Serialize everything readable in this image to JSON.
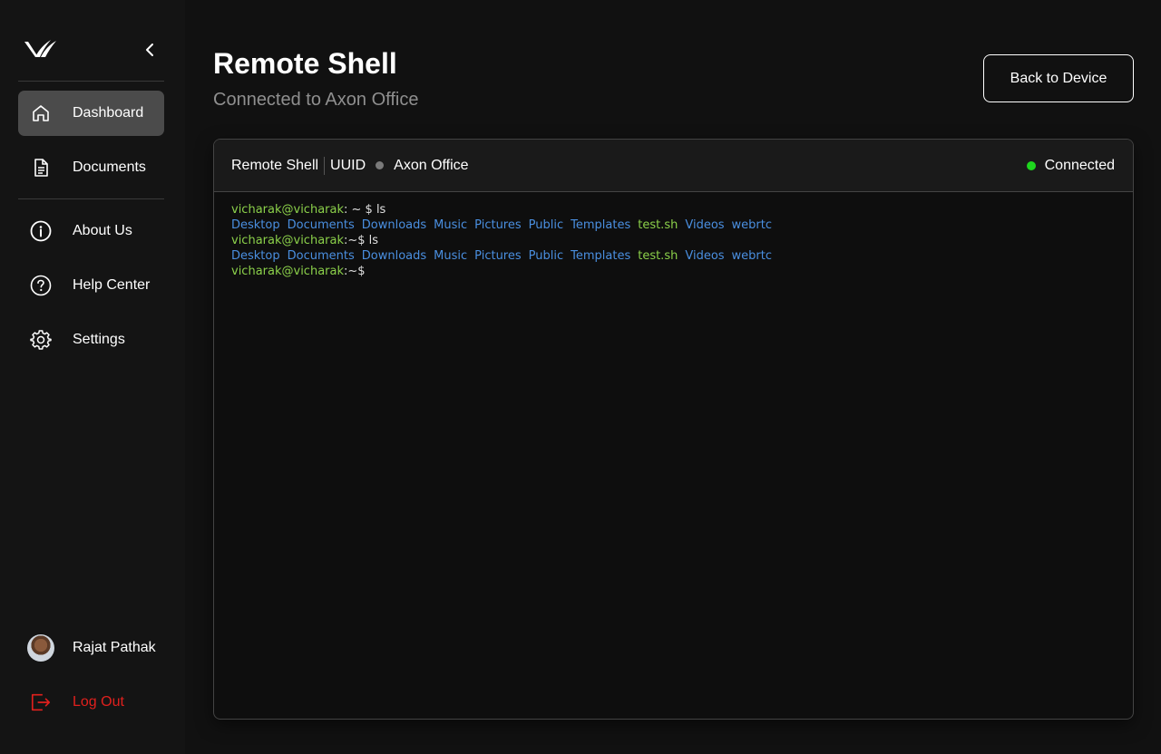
{
  "sidebar": {
    "nav_items": [
      {
        "label": "Dashboard"
      },
      {
        "label": "Documents"
      },
      {
        "label": "About Us"
      },
      {
        "label": "Help Center"
      },
      {
        "label": "Settings"
      }
    ],
    "user": {
      "name": "Rajat Pathak"
    },
    "logout_label": "Log Out"
  },
  "header": {
    "title": "Remote Shell",
    "subtitle": "Connected to Axon Office",
    "back_button": "Back to Device"
  },
  "panel": {
    "title": "Remote Shell",
    "uuid_label": "UUID",
    "device_name": "Axon Office",
    "status": "Connected"
  },
  "terminal": {
    "line1": {
      "prompt": "vicharak@vicharak",
      "rest": ": ~ $ ls"
    },
    "line2": {
      "items": [
        "Desktop",
        "Documents",
        "Downloads",
        "Music",
        "Pictures",
        "Public",
        "Templates",
        "test.sh",
        "Videos",
        "webrtc"
      ]
    },
    "line3": {
      "prompt": "vicharak@vicharak",
      "rest": ":~$ ls"
    },
    "line4": {
      "items": [
        "Desktop",
        "Documents",
        "Downloads",
        "Music",
        "Pictures",
        "Public",
        "Templates",
        "test.sh",
        "Videos",
        "webrtc"
      ]
    },
    "line5": {
      "prompt": "vicharak@vicharak",
      "rest": ":~$"
    }
  },
  "colors": {
    "accent_green": "#1ed61e",
    "prompt_green": "#8bd04a",
    "dir_blue": "#4a8fe0",
    "logout_red": "#e0201d",
    "active_nav": "#4b4b4b"
  }
}
